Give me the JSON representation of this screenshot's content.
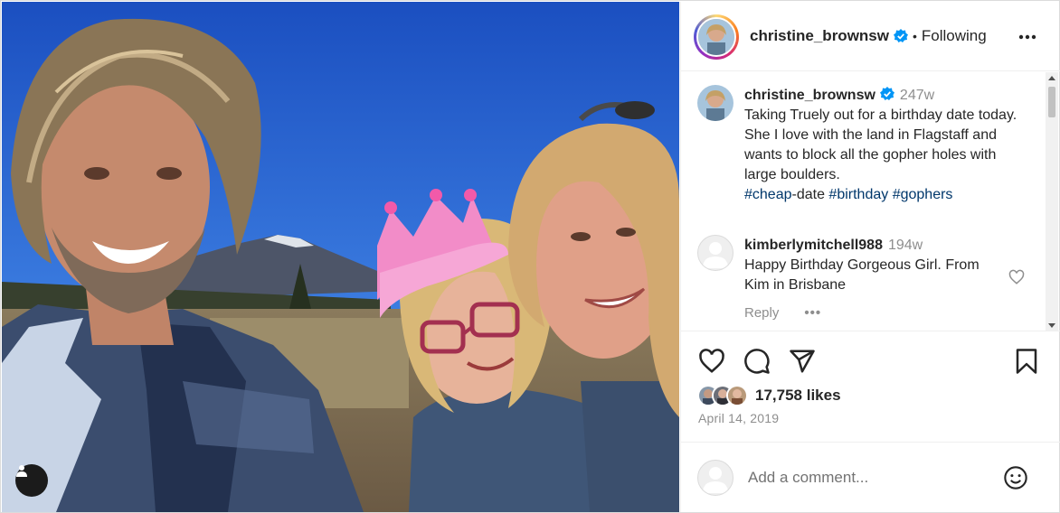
{
  "header": {
    "username": "christine_brownsw",
    "separator": "•",
    "follow_status": "Following",
    "more_icon": "more-horizontal-icon"
  },
  "caption": {
    "username": "christine_brownsw",
    "time": "247w",
    "text": "Taking Truely out for a birthday date today. She I love with the land in Flagstaff and wants to block all the gopher holes with large boulders.",
    "hashtags": [
      "#cheap",
      "-date",
      "#birthday",
      "#gophers"
    ]
  },
  "comments": [
    {
      "username": "kimberlymitchell988",
      "time": "194w",
      "text": "Happy Birthday Gorgeous Girl. From Kim in Brisbane",
      "reply_label": "Reply",
      "more_label": "•••"
    }
  ],
  "actions": {
    "like_icon": "heart-icon",
    "comment_icon": "comment-icon",
    "share_icon": "share-icon",
    "save_icon": "bookmark-icon"
  },
  "likes": {
    "count": "17,758 likes"
  },
  "post_date": "April 14, 2019",
  "add_comment": {
    "placeholder": "Add a comment...",
    "emoji_icon": "emoji-icon"
  },
  "colors": {
    "text": "#262626",
    "muted": "#8e8e8e",
    "verified": "#0095f6",
    "hashtag": "#00376b",
    "border": "#efefef"
  }
}
